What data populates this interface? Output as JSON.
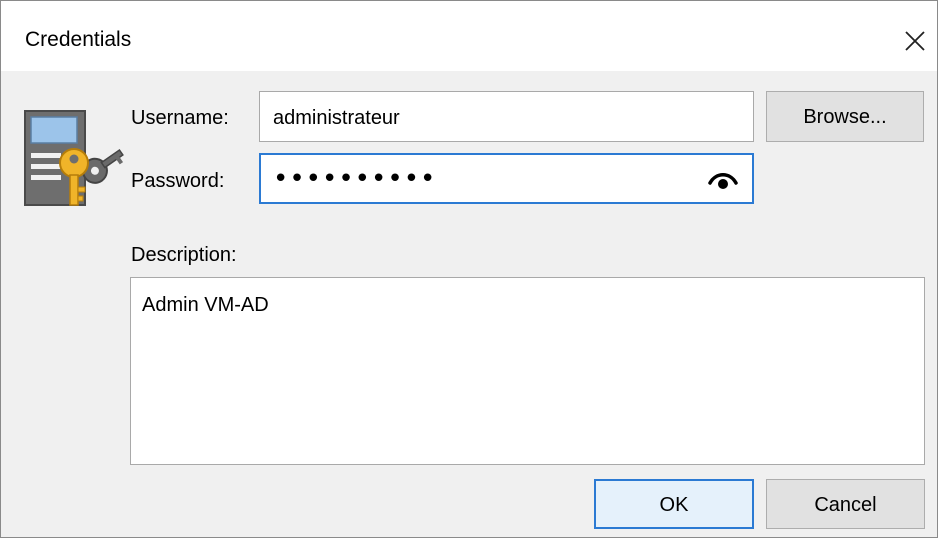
{
  "window": {
    "title": "Credentials"
  },
  "form": {
    "username_label": "Username:",
    "username_value": "administrateur",
    "password_label": "Password:",
    "password_mask": "••••••••••",
    "description_label": "Description:",
    "description_value": "Admin VM-AD"
  },
  "buttons": {
    "browse": "Browse...",
    "ok": "OK",
    "cancel": "Cancel"
  },
  "icons": {
    "close": "close-icon",
    "credentials": "credentials-key-icon",
    "show_password": "eye-icon"
  },
  "colors": {
    "focus_border": "#2b7ad3",
    "dialog_background": "#f0f0f0",
    "key": "#f0b429"
  }
}
